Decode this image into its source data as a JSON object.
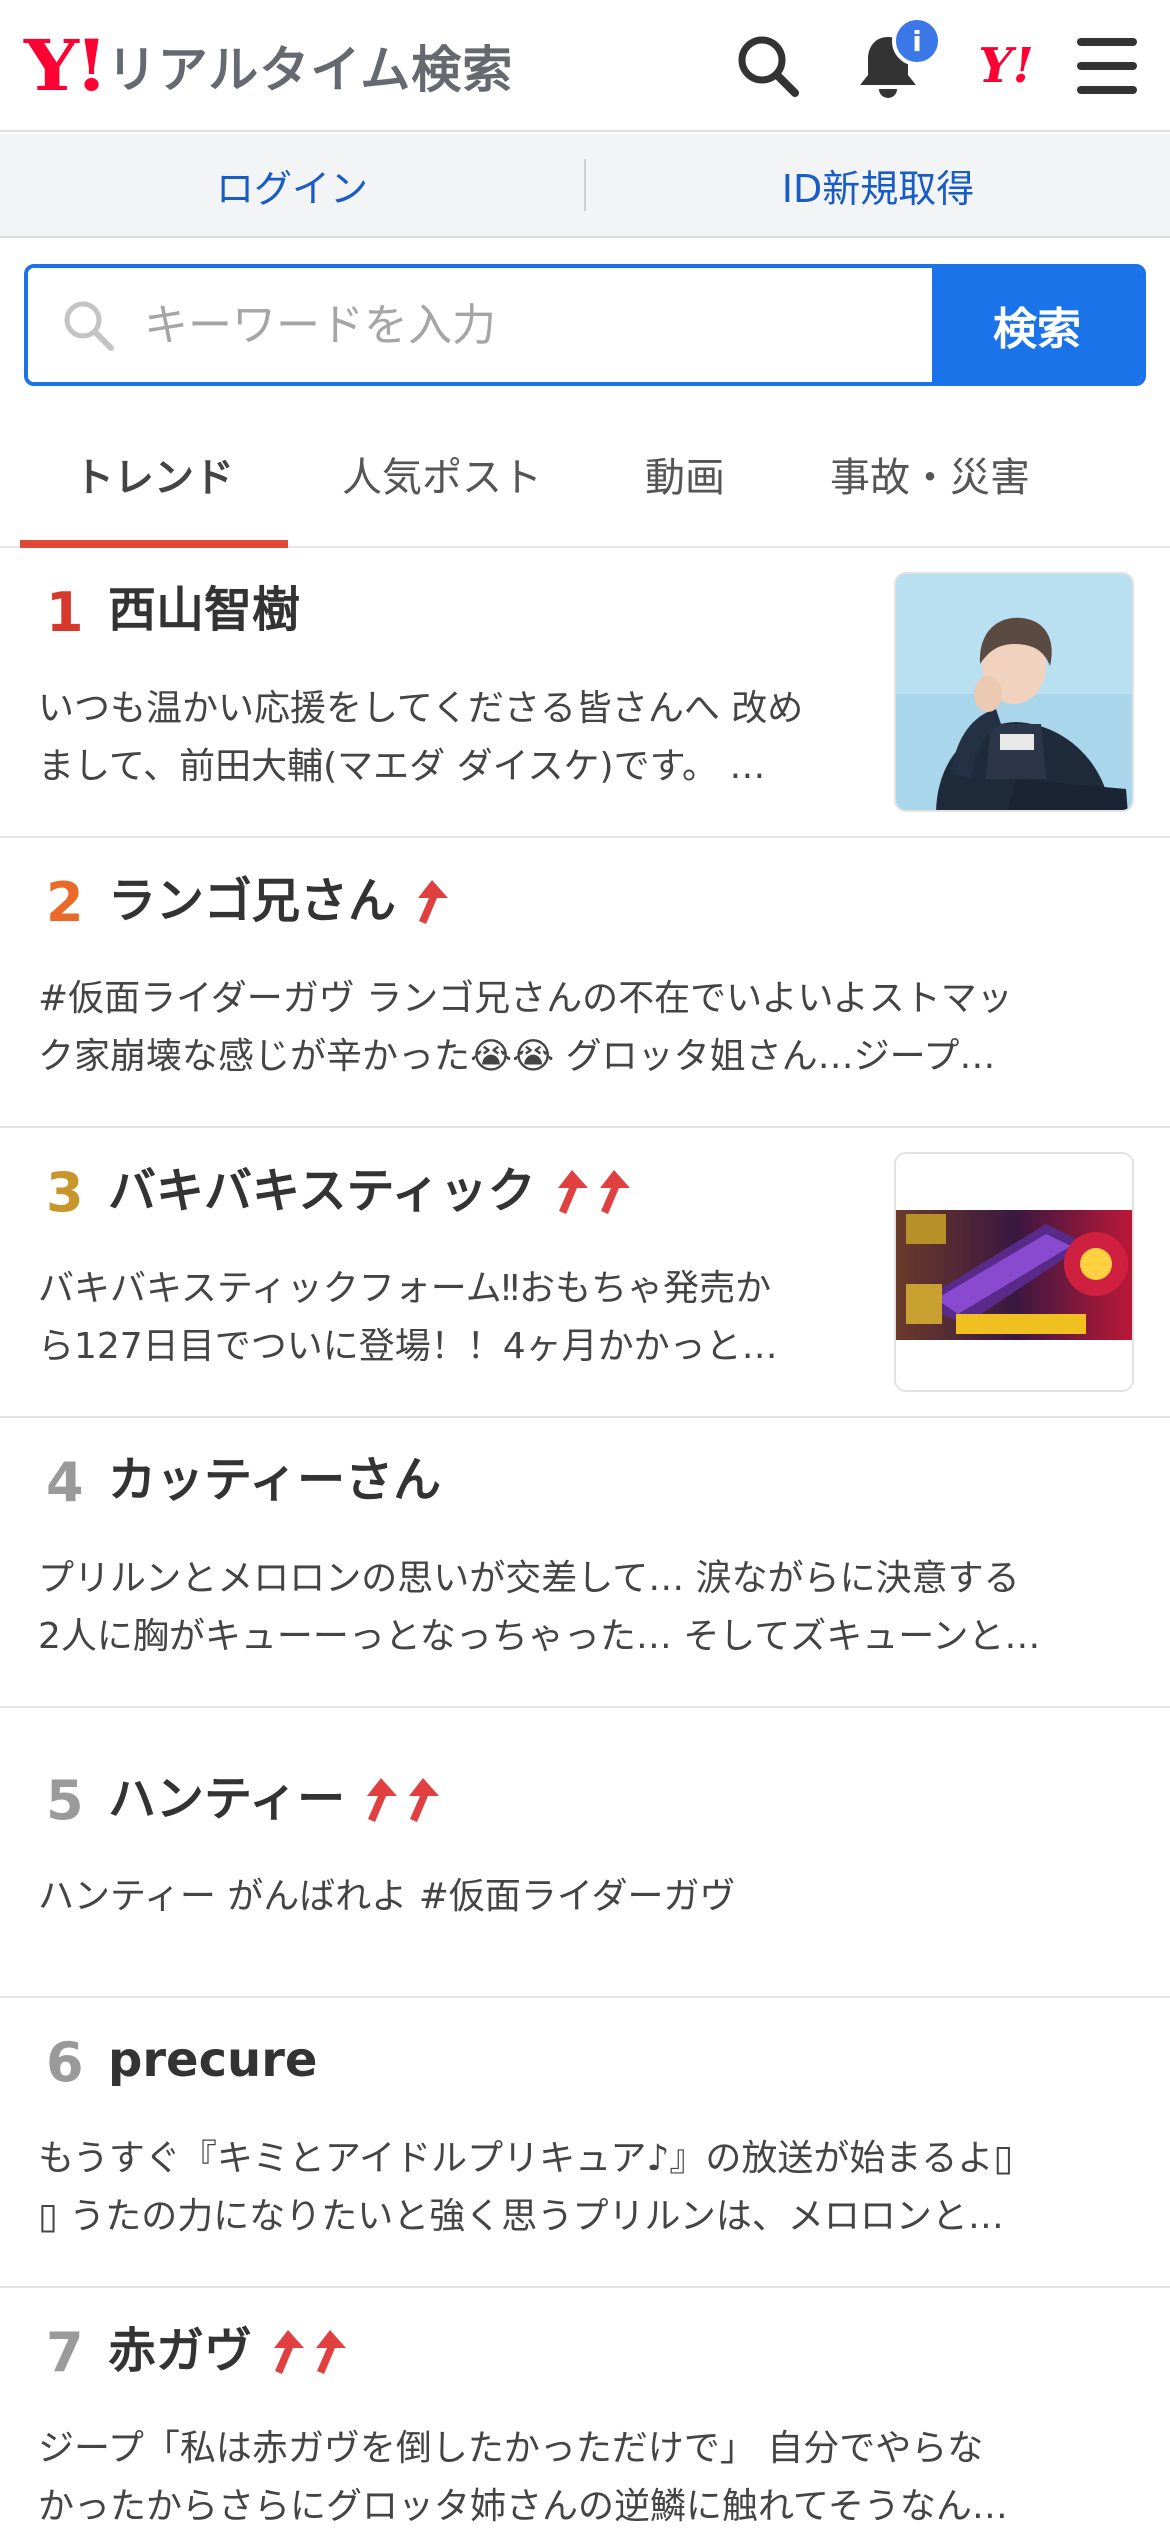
{
  "header": {
    "logo_mark": "Y!",
    "title": "リアルタイム検索",
    "notification_badge": "i",
    "yahoo_mark": "Y!"
  },
  "account": {
    "login": "ログイン",
    "signup": "ID新規取得"
  },
  "search": {
    "placeholder": "キーワードを入力",
    "button": "検索"
  },
  "tabs": [
    {
      "label": "トレンド",
      "active": true
    },
    {
      "label": "人気ポスト",
      "active": false
    },
    {
      "label": "動画",
      "active": false
    },
    {
      "label": "事故・災害",
      "active": false
    }
  ],
  "colors": {
    "brand_red": "#ff0033",
    "link_blue": "#1a5cc5",
    "search_blue": "#1a73e8",
    "tab_underline": "#e0493a",
    "rank1": "#d6392b",
    "rank2": "#ea6a2a",
    "rank3": "#c8962a",
    "rank_other": "#9a9a9a",
    "trend_arrow": "#e04040"
  },
  "trends": [
    {
      "rank": "1",
      "title": "西山智樹",
      "rising": 0,
      "has_image": true,
      "image": "portrait-photo",
      "desc1": "いつも温かい応援をしてくださる皆さんへ 改め",
      "desc2": "まして、前田大輔(マエダ ダイスケ)です。 …"
    },
    {
      "rank": "2",
      "title": "ランゴ兄さん",
      "rising": 1,
      "has_image": false,
      "desc1": "#仮面ライダーガヴ ランゴ兄さんの不在でいよいよストマッ",
      "desc2": "ク家崩壊な感じが辛かった😭😭 グロッタ姐さん…ジープ…"
    },
    {
      "rank": "3",
      "title": "バキバキスティック",
      "rising": 2,
      "has_image": true,
      "image": "toy-package-photo",
      "desc1": "バキバキスティックフォーム‼︎おもちゃ発売か",
      "desc2": "ら127日目でついに登場！！4ヶ月かかっと…"
    },
    {
      "rank": "4",
      "title": "カッティーさん",
      "rising": 0,
      "has_image": false,
      "desc1": "プリルンとメロロンの思いが交差して… 涙ながらに決意する",
      "desc2": "2人に胸がキューーっとなっちゃった… そしてズキューンと…"
    },
    {
      "rank": "5",
      "title": "ハンティー",
      "rising": 2,
      "has_image": false,
      "desc1": "ハンティー がんばれよ #仮面ライダーガヴ",
      "desc2": ""
    },
    {
      "rank": "6",
      "title": "precure",
      "rising": 0,
      "has_image": false,
      "desc1": "もうすぐ『キミとアイドルプリキュア♪』の放送が始まるよ▯",
      "desc2": "▯ うたの力になりたいと強く思うプリルンは、メロロンと…"
    },
    {
      "rank": "7",
      "title": "赤ガヴ",
      "rising": 2,
      "has_image": false,
      "desc1": "ジープ「私は赤ガヴを倒したかっただけで」 自分でやらな",
      "desc2": "かったからさらにグロッタ姉さんの逆鱗に触れてそうなん…"
    }
  ]
}
